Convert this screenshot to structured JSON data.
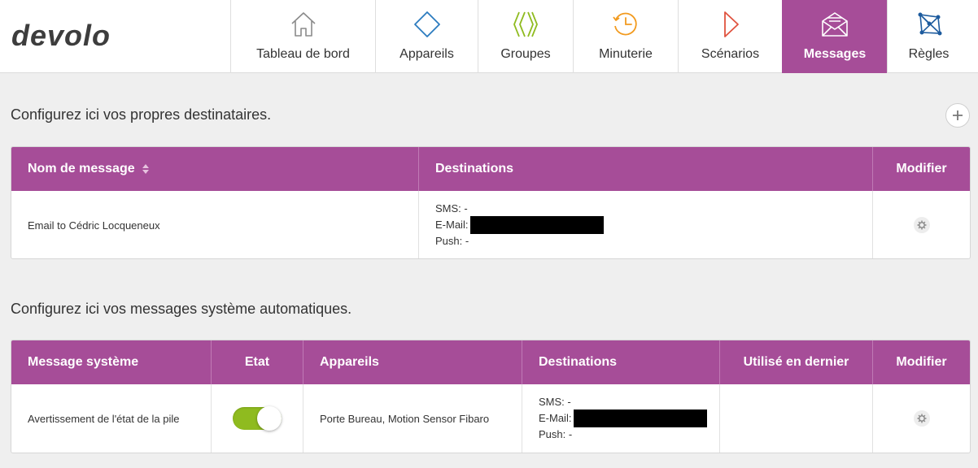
{
  "brand": {
    "logo_text": "devolo"
  },
  "nav": {
    "items": [
      {
        "label": "Tableau de bord",
        "icon": "house-icon",
        "active": false
      },
      {
        "label": "Appareils",
        "icon": "diamond-icon",
        "active": false
      },
      {
        "label": "Groupes",
        "icon": "groups-chevrons-icon",
        "active": false
      },
      {
        "label": "Minuterie",
        "icon": "clock-icon",
        "active": false
      },
      {
        "label": "Scénarios",
        "icon": "play-triangle-icon",
        "active": false
      },
      {
        "label": "Messages",
        "icon": "envelope-icon",
        "active": true
      },
      {
        "label": "Règles",
        "icon": "network-rules-icon",
        "active": false
      }
    ]
  },
  "recipients": {
    "title": "Configurez ici vos propres destinataires.",
    "add_label": "+",
    "headers": {
      "name": "Nom de message",
      "destinations": "Destinations",
      "modify": "Modifier"
    },
    "rows": [
      {
        "name": "Email to Cédric Locqueneux",
        "sms": "SMS: -",
        "email": "E-Mail:",
        "push": "Push: -"
      }
    ]
  },
  "system": {
    "title": "Configurez ici vos messages système automatiques.",
    "headers": {
      "message": "Message système",
      "state": "Etat",
      "devices": "Appareils",
      "destinations": "Destinations",
      "last_used": "Utilisé en dernier",
      "modify": "Modifier"
    },
    "rows": [
      {
        "message": "Avertissement de l'état de la pile",
        "state_on": true,
        "devices": "Porte Bureau, Motion Sensor Fibaro",
        "sms": "SMS: -",
        "email": "E-Mail:",
        "push": "Push: -",
        "last_used": ""
      }
    ]
  },
  "colors": {
    "accent": "#a64d98",
    "toggle_on": "#8fbb1f",
    "brand_logo": "#3d3d3d"
  }
}
